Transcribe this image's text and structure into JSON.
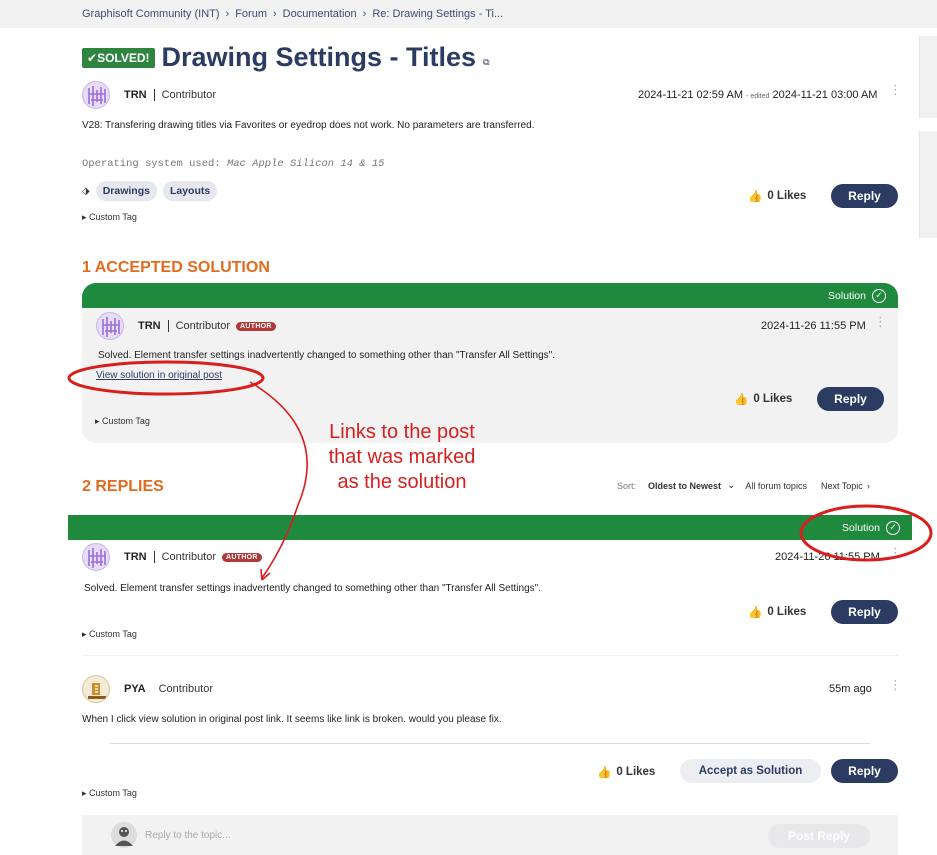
{
  "breadcrumb": {
    "items": [
      "Graphisoft Community (INT)",
      "Forum",
      "Documentation",
      "Re: Drawing Settings - Ti..."
    ]
  },
  "topic": {
    "solved_badge": "SOLVED!",
    "title": "Drawing Settings - Titles",
    "author": "TRN",
    "rank": "Contributor",
    "posted": "2024-11-21 02:59 AM",
    "edited_label": "- edited",
    "edited": "2024-11-21 03:00 AM",
    "body": "V28: Transfering drawing titles via Favorites or eyedrop does not work. No parameters are transferred.",
    "os_label": "Operating system used:",
    "os_value": "Mac Apple Silicon 14 & 15",
    "tags": [
      "Drawings",
      "Layouts"
    ],
    "likes": "0 Likes",
    "reply": "Reply",
    "custom_tag": "Custom Tag"
  },
  "accepted": {
    "heading": "1 ACCEPTED SOLUTION",
    "solution_label": "Solution",
    "author": "TRN",
    "rank": "Contributor",
    "author_badge": "AUTHOR",
    "posted": "2024-11-26 11:55 PM",
    "body": "Solved. Element transfer settings inadvertently changed to something other than \"Transfer All Settings\".",
    "view_link": "View solution in original post",
    "likes": "0 Likes",
    "reply": "Reply",
    "custom_tag": "Custom Tag"
  },
  "replies": {
    "heading": "2 REPLIES",
    "sort_label": "Sort:",
    "sort_value": "Oldest to Newest",
    "all_topics": "All forum topics",
    "next_topic": "Next Topic"
  },
  "reply1": {
    "solution_label": "Solution",
    "author": "TRN",
    "rank": "Contributor",
    "author_badge": "AUTHOR",
    "posted": "2024-11-26 11:55 PM",
    "body": "Solved. Element transfer settings inadvertently changed to something other than \"Transfer All Settings\".",
    "likes": "0 Likes",
    "reply": "Reply",
    "custom_tag": "Custom Tag"
  },
  "reply2": {
    "author": "PYA",
    "rank": "Contributor",
    "posted": "55m ago",
    "body": "When I click view solution in original post link. It seems like link is broken.  would you please fix.",
    "likes": "0 Likes",
    "accept": "Accept as Solution",
    "reply": "Reply",
    "custom_tag": "Custom Tag"
  },
  "compose": {
    "placeholder": "Reply to the topic...",
    "post_button": "Post Reply"
  },
  "annotation": {
    "lines": [
      "Links to the post",
      "that was marked",
      "as the solution"
    ]
  },
  "colors": {
    "brand_navy": "#2b3b62",
    "solution_green": "#1f8a3e",
    "heading_orange": "#e36b1f",
    "annotation_red": "#d91e1e"
  }
}
